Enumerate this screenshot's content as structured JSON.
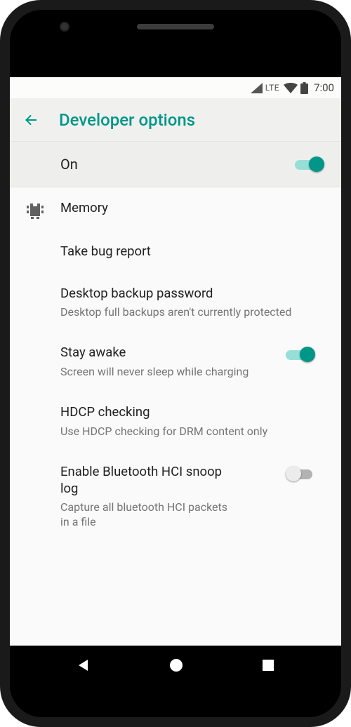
{
  "status": {
    "network_label": "LTE",
    "time": "7:00"
  },
  "appbar": {
    "title": "Developer options"
  },
  "master": {
    "label": "On",
    "enabled": true
  },
  "items": {
    "memory": {
      "title": "Memory"
    },
    "bugreport": {
      "title": "Take bug report"
    },
    "backup": {
      "title": "Desktop backup password",
      "subtitle": "Desktop full backups aren't currently protected"
    },
    "stayawake": {
      "title": "Stay awake",
      "subtitle": "Screen will never sleep while charging",
      "enabled": true
    },
    "hdcp": {
      "title": "HDCP checking",
      "subtitle": "Use HDCP checking for DRM content only"
    },
    "btsnoop": {
      "title": "Enable Bluetooth HCI snoop log",
      "subtitle": "Capture all bluetooth HCI packets in a file",
      "enabled": false
    }
  }
}
